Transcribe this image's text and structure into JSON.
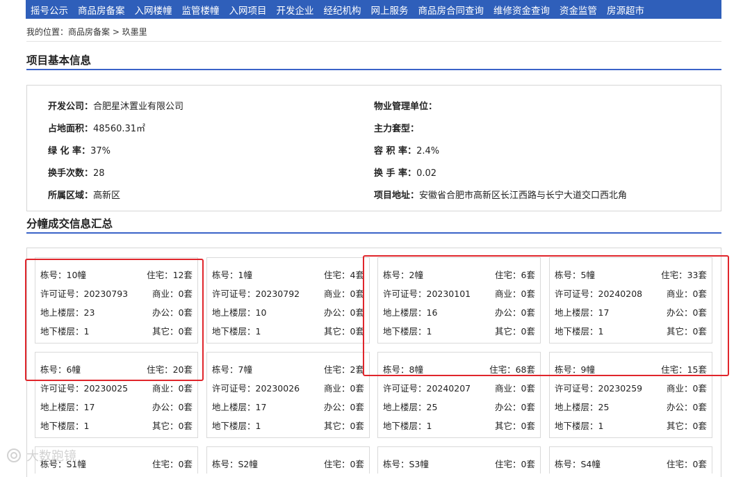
{
  "nav": {
    "items": [
      "摇号公示",
      "商品房备案",
      "入网楼幢",
      "监管楼幢",
      "入网项目",
      "开发企业",
      "经纪机构",
      "网上服务",
      "商品房合同查询",
      "维修资金查询",
      "资金监管",
      "房源超市"
    ]
  },
  "breadcrumb": {
    "text": "我的位置：商品房备案 > 玖墨里"
  },
  "sections": {
    "basic": "项目基本信息",
    "summary": "分幢成交信息汇总"
  },
  "info": {
    "developer_label": "开发公司：",
    "developer_value": "合肥星沐置业有限公司",
    "property_label": "物业管理单位：",
    "property_value": "",
    "area_label": "占地面积：",
    "area_value": "48560.31㎡",
    "main_type_label": "主力套型：",
    "main_type_value": "",
    "green_label": "绿 化 率：",
    "green_value": "37%",
    "plot_label": "容 积 率：",
    "plot_value": "2.4%",
    "hand_label": "换手次数：",
    "hand_value": "28",
    "turnover_label": "换 手 率：",
    "turnover_value": "0.02",
    "district_label": "所属区域：",
    "district_value": "高新区",
    "address_label": "项目地址：",
    "address_value": "安徽省合肥市高新区长江西路与长宁大道交口西北角"
  },
  "buildings": [
    {
      "l1": "栋号：10幢",
      "r1": "住宅：12套",
      "l2": "许可证号：20230793",
      "r2": "商业：0套",
      "l3": "地上楼层：23",
      "r3": "办公：0套",
      "l4": "地下楼层：1",
      "r4": "其它：0套"
    },
    {
      "l1": "栋号：1幢",
      "r1": "住宅：4套",
      "l2": "许可证号：20230792",
      "r2": "商业：0套",
      "l3": "地上楼层：10",
      "r3": "办公：0套",
      "l4": "地下楼层：1",
      "r4": "其它：0套"
    },
    {
      "l1": "栋号：2幢",
      "r1": "住宅：6套",
      "l2": "许可证号：20230101",
      "r2": "商业：0套",
      "l3": "地上楼层：16",
      "r3": "办公：0套",
      "l4": "地下楼层：1",
      "r4": "其它：0套"
    },
    {
      "l1": "栋号：5幢",
      "r1": "住宅：33套",
      "l2": "许可证号：20240208",
      "r2": "商业：0套",
      "l3": "地上楼层：17",
      "r3": "办公：0套",
      "l4": "地下楼层：1",
      "r4": "其它：0套"
    },
    {
      "l1": "栋号：6幢",
      "r1": "住宅：20套",
      "l2": "许可证号：20230025",
      "r2": "商业：0套",
      "l3": "地上楼层：17",
      "r3": "办公：0套",
      "l4": "地下楼层：1",
      "r4": "其它：0套"
    },
    {
      "l1": "栋号：7幢",
      "r1": "住宅：2套",
      "l2": "许可证号：20230026",
      "r2": "商业：0套",
      "l3": "地上楼层：17",
      "r3": "办公：0套",
      "l4": "地下楼层：1",
      "r4": "其它：0套"
    },
    {
      "l1": "栋号：8幢",
      "r1": "住宅：68套",
      "l2": "许可证号：20240207",
      "r2": "商业：0套",
      "l3": "地上楼层：25",
      "r3": "办公：0套",
      "l4": "地下楼层：1",
      "r4": "其它：0套"
    },
    {
      "l1": "栋号：9幢",
      "r1": "住宅：15套",
      "l2": "许可证号：20230259",
      "r2": "商业：0套",
      "l3": "地上楼层：25",
      "r3": "办公：0套",
      "l4": "地下楼层：1",
      "r4": "其它：0套"
    },
    {
      "l1": "栋号：S1幢",
      "r1": "住宅：0套"
    },
    {
      "l1": "栋号：S2幢",
      "r1": "住宅：0套"
    },
    {
      "l1": "栋号：S3幢",
      "r1": "住宅：0套"
    },
    {
      "l1": "栋号：S4幢",
      "r1": "住宅：0套"
    }
  ],
  "watermark": {
    "text": "大数跑镜"
  },
  "colors": {
    "nav_bg": "#2f5fba",
    "section_line": "#3a63c8",
    "highlight": "#e0252b"
  }
}
